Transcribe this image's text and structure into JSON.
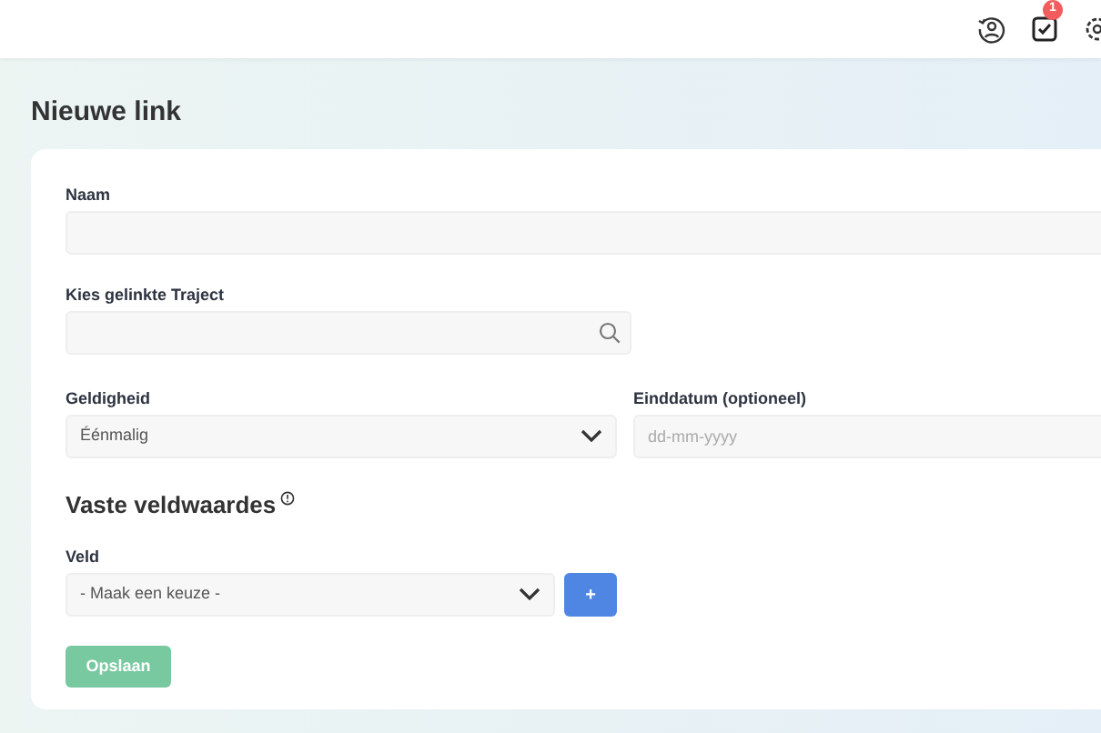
{
  "topbar": {
    "notification_badge": "1"
  },
  "page": {
    "title": "Nieuwe link"
  },
  "form": {
    "name": {
      "label": "Naam"
    },
    "traject": {
      "label": "Kies gelinkte Traject"
    },
    "geldigheid": {
      "label": "Geldigheid",
      "value": "Éénmalig"
    },
    "einddatum": {
      "label": "Einddatum (optioneel)",
      "placeholder": "dd-mm-yyyy"
    },
    "section_title": "Vaste veldwaardes",
    "veld": {
      "label": "Veld",
      "value": "- Maak een keuze -"
    },
    "add_button": "+",
    "save_button": "Opslaan"
  }
}
